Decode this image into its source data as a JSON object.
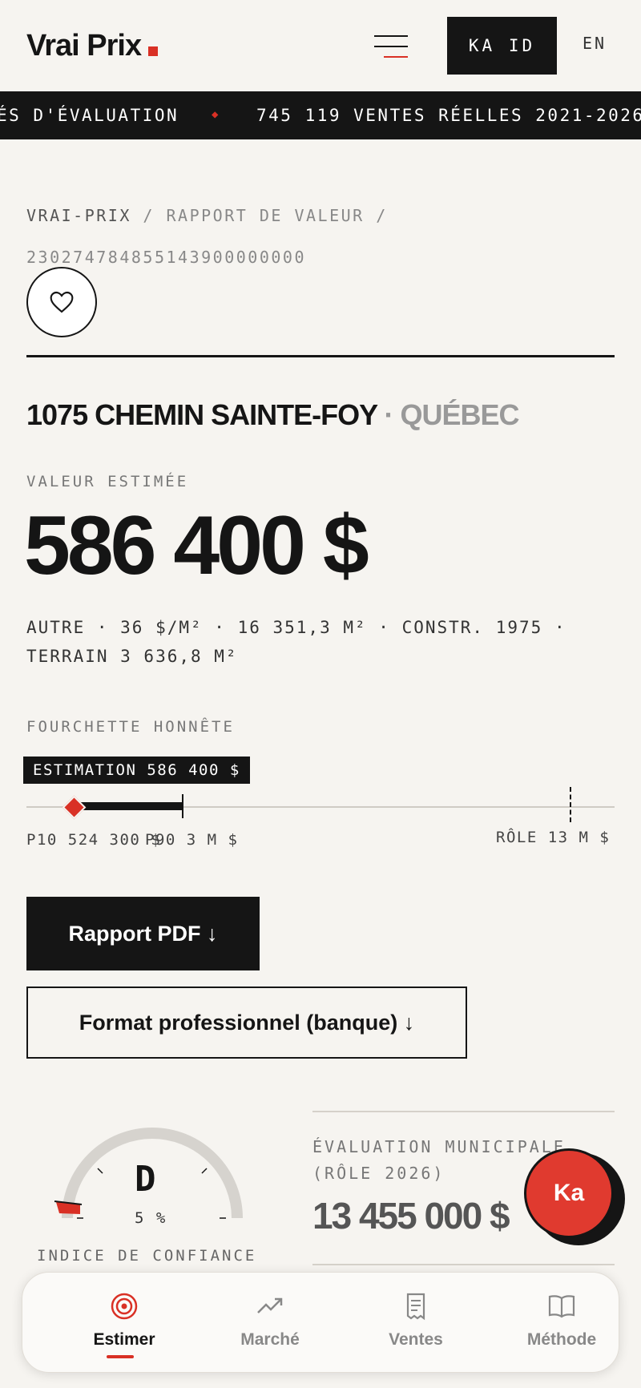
{
  "header": {
    "logo": "Vrai Prix",
    "ka_id_button": "KA ID",
    "lang_toggle": "EN"
  },
  "ticker": {
    "items": [
      "ÉS D'ÉVALUATION",
      "745 119 VENTES RÉELLES 2021-2026"
    ]
  },
  "breadcrumb": {
    "root": "VRAI-PRIX",
    "section": "RAPPORT DE VALEUR",
    "id": "230274784855143900000000"
  },
  "property": {
    "address": "1075 CHEMIN SAINTE-FOY",
    "city_separator": "·",
    "city": "QUÉBEC",
    "value_label": "VALEUR ESTIMÉE",
    "value": "586 400 $",
    "specs_line1": "AUTRE · 36 $/M² · 16 351,3 M² · CONSTR. 1975 ·",
    "specs_line2": "TERRAIN 3 636,8 M²"
  },
  "range": {
    "label": "FOURCHETTE HONNÊTE",
    "estimate_badge": "ESTIMATION 586 400 $",
    "p10_label": "P10 524 300 $",
    "p90_label": "P90 3 M $",
    "role_label": "RÔLE 13 M $"
  },
  "actions": {
    "pdf_button": "Rapport PDF ↓",
    "pro_button": "Format professionnel (banque) ↓"
  },
  "confidence": {
    "grade": "D",
    "percent": "5 %",
    "label": "INDICE DE CONFIANCE",
    "level": 0.05
  },
  "municipal": {
    "label_line1": "ÉVALUATION MUNICIPALE",
    "label_line2": "(RÔLE 2026)",
    "value": "13 455 000 $"
  },
  "ka_button": "Ka",
  "nav": {
    "items": [
      {
        "label": "Estimer",
        "icon": "target-icon",
        "active": true
      },
      {
        "label": "Marché",
        "icon": "trend-up-icon",
        "active": false
      },
      {
        "label": "Ventes",
        "icon": "receipt-icon",
        "active": false
      },
      {
        "label": "Méthode",
        "icon": "book-icon",
        "active": false
      }
    ]
  },
  "colors": {
    "accent": "#d93025",
    "ink": "#151515",
    "background": "#f6f4f0"
  }
}
